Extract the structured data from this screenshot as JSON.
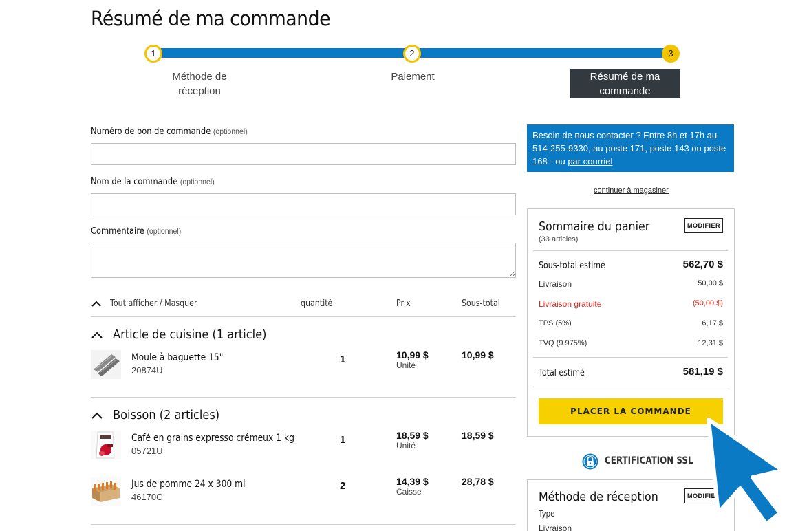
{
  "page": {
    "title": "Résumé de ma commande"
  },
  "stepper": {
    "steps": [
      {
        "number": "1",
        "label_line1": "Méthode de",
        "label_line2": "réception"
      },
      {
        "number": "2",
        "label_line1": "Paiement",
        "label_line2": ""
      },
      {
        "number": "3",
        "label_line1": "Résumé de ma",
        "label_line2": "commande"
      }
    ],
    "active_step": 3
  },
  "form": {
    "po_number": {
      "label": "Numéro de bon de commande",
      "optional": "(optionnel)",
      "value": ""
    },
    "order_name": {
      "label": "Nom de la commande",
      "optional": "(optionnel)",
      "value": ""
    },
    "comment": {
      "label": "Commentaire",
      "optional": "(optionnel)",
      "value": ""
    }
  },
  "table": {
    "toggle_label": "Tout afficher / Masquer",
    "col_quantity": "quantité",
    "col_price": "Prix",
    "col_subtotal": "Sous-total",
    "groups": [
      {
        "title": "Article de cuisine (1 article)",
        "items": [
          {
            "name": "Moule à baguette 15\"",
            "code": "20874U",
            "quantity": "1",
            "price": "10,99 $",
            "unit": "Unité",
            "subtotal": "10,99 $"
          }
        ]
      },
      {
        "title": "Boisson (2 articles)",
        "items": [
          {
            "name": "Café en grains expresso crémeux 1 kg",
            "code": "05721U",
            "quantity": "1",
            "price": "18,59 $",
            "unit": "Unité",
            "subtotal": "18,59 $"
          },
          {
            "name": "Jus de pomme 24 x 300 ml",
            "code": "46170C",
            "quantity": "2",
            "price": "14,39 $",
            "unit": "Caisse",
            "subtotal": "28,78 $"
          }
        ]
      }
    ]
  },
  "contact": {
    "text": "Besoin de nous contacter ? Entre 8h et 17h au 514-255-9330, au poste 171, poste 143 ou poste 168 - ou ",
    "link": "par courriel"
  },
  "continue_shopping": "continuer à magasiner",
  "cart_summary": {
    "title": "Sommaire du panier",
    "count": "(33 articles)",
    "modify_label": "MODIFIER",
    "subtotal_label": "Sous-total estimé",
    "subtotal_value": "562,70 $",
    "delivery_label": "Livraison",
    "delivery_value": "50,00 $",
    "free_delivery_label": "Livraison gratuite",
    "free_delivery_value": "(50,00 $)",
    "tps_label": "TPS (5%)",
    "tps_value": "6,17 $",
    "tvq_label": "TVQ (9.975%)",
    "tvq_value": "12,31 $",
    "total_label": "Total estimé",
    "total_value": "581,19 $",
    "place_order_label": "PLACER LA COMMANDE"
  },
  "ssl": {
    "label": "CERTIFICATION SSL"
  },
  "reception_box": {
    "title": "Méthode de réception",
    "modify_label": "MODIFIER",
    "type_label": "Type",
    "type_value": "Livraison"
  },
  "colors": {
    "accent_blue": "#0a7ac4",
    "accent_yellow": "#f7d000",
    "step_active_bg": "#323a40",
    "discount_red": "#d9261c"
  }
}
